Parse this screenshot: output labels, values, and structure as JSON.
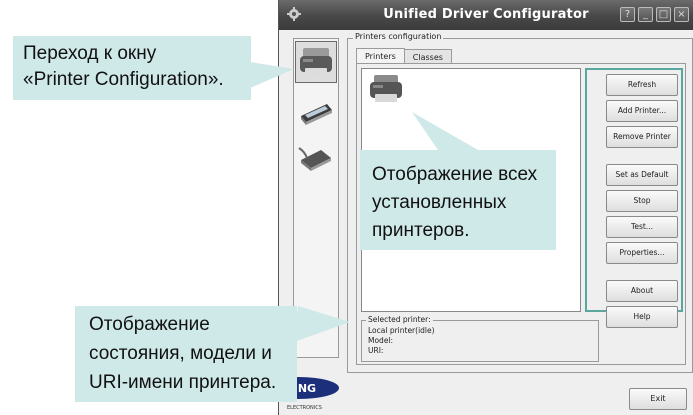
{
  "window": {
    "title": "Unified Driver Configurator",
    "buttons": [
      "?",
      "_",
      "□",
      "×"
    ]
  },
  "sidebar": {
    "items": [
      {
        "name": "printer-configuration",
        "icon": "printer-icon",
        "active": true
      },
      {
        "name": "scanner-configuration",
        "icon": "scanner-icon",
        "active": false
      },
      {
        "name": "ports-configuration",
        "icon": "port-icon",
        "active": false
      }
    ]
  },
  "group": {
    "legend": "Printers configuration",
    "tabs": [
      {
        "label": "Printers",
        "active": true
      },
      {
        "label": "Classes",
        "active": false
      }
    ]
  },
  "buttons": {
    "refresh": "Refresh",
    "add_printer": "Add Printer...",
    "remove_printer": "Remove Printer",
    "set_default": "Set as Default",
    "stop": "Stop",
    "test": "Test...",
    "properties": "Properties...",
    "about": "About",
    "help": "Help",
    "exit": "Exit"
  },
  "selected_printer": {
    "legend": "Selected printer:",
    "status": "Local printer(idle)",
    "model": "Model:",
    "uri": "URI:"
  },
  "brand": {
    "text": "SUNG",
    "sub": "ELECTRONICS"
  },
  "callouts": {
    "top_left": {
      "line1": "Переход к окну",
      "line2": "«Printer Configuration»."
    },
    "center": {
      "line1": "Отображение всех",
      "line2": "установленных",
      "line3": "принтеров."
    },
    "bottom_left": {
      "line1": "Отображение",
      "line2": "состояния, модели и",
      "line3": "URI-имени принтера."
    }
  },
  "colors": {
    "callout_bg": "#cfe8e8",
    "highlight_border": "#5aa7a0",
    "titlebar": "#4a4a4a"
  }
}
